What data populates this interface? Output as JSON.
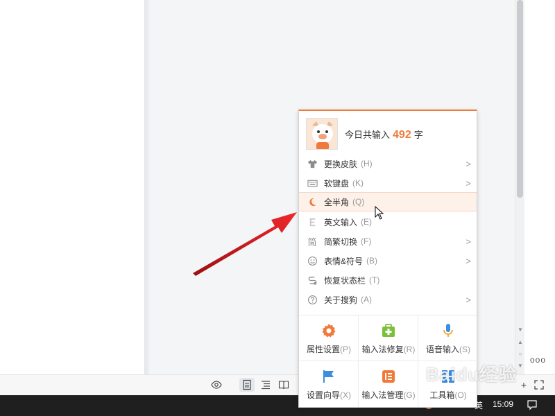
{
  "menu": {
    "header": {
      "prefix": "今日共输入",
      "count": "492",
      "suffix": "字"
    },
    "items": [
      {
        "label": "更换皮肤",
        "key": "(H)",
        "submenu": true,
        "icon": "shirt-icon"
      },
      {
        "label": "软键盘",
        "key": "(K)",
        "submenu": true,
        "icon": "keyboard-icon"
      },
      {
        "label": "全半角",
        "key": "(Q)",
        "submenu": false,
        "icon": "moon-icon"
      },
      {
        "label": "英文输入",
        "key": "(E)",
        "submenu": false,
        "icon": "letter-e-icon"
      },
      {
        "label": "简繁切换",
        "key": "(F)",
        "submenu": true,
        "icon": "jian-char-icon",
        "icon_char": "简"
      },
      {
        "label": "表情&符号",
        "key": "(B)",
        "submenu": true,
        "icon": "smiley-icon"
      },
      {
        "label": "恢复状态栏",
        "key": "(T)",
        "submenu": false,
        "icon": "statusbar-restore-icon"
      },
      {
        "label": "关于搜狗",
        "key": "(A)",
        "submenu": true,
        "icon": "question-circle-icon"
      }
    ],
    "tiles": [
      {
        "label": "属性设置",
        "key": "(P)",
        "icon": "gear-icon"
      },
      {
        "label": "输入法修复",
        "key": "(R)",
        "icon": "repair-kit-icon"
      },
      {
        "label": "语音输入",
        "key": "(S)",
        "icon": "microphone-icon"
      },
      {
        "label": "设置向导",
        "key": "(X)",
        "icon": "flag-icon"
      },
      {
        "label": "输入法管理",
        "key": "(G)",
        "icon": "manage-list-icon"
      },
      {
        "label": "工具箱",
        "key": "(O)",
        "icon": "toolbox-icon"
      }
    ],
    "arrow_char": ">"
  },
  "editor": {
    "more": "ooo"
  },
  "taskbar": {
    "ime_mode": "英",
    "time": "15:09"
  },
  "watermark": "Baidu经验",
  "colors": {
    "accent": "#f07a3a",
    "arrow": "#e31e24",
    "taskbar": "#1f1f1f"
  }
}
